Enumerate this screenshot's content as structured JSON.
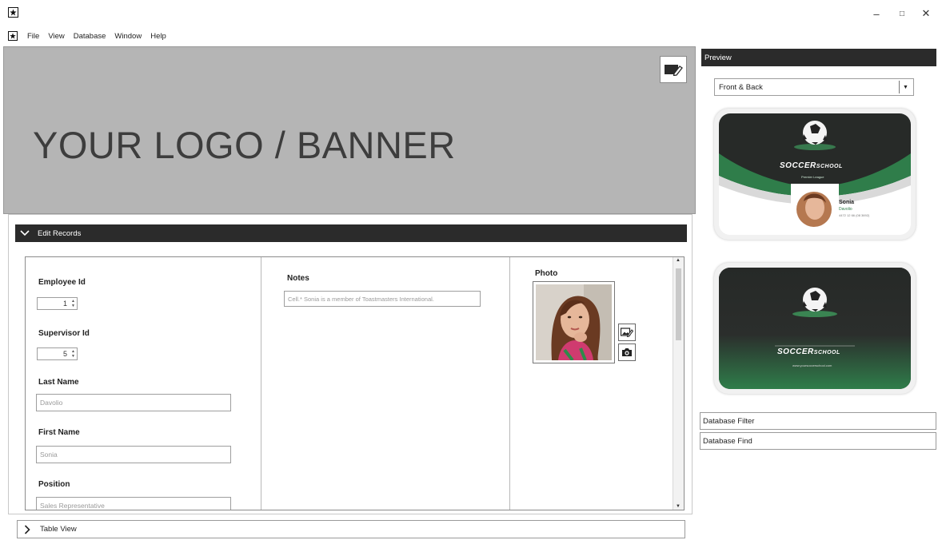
{
  "app": {
    "icon_name": "app-star-icon",
    "window_controls": {
      "minimize": "–",
      "maximize": "□",
      "close": "✕"
    }
  },
  "menu": [
    "File",
    "View",
    "Database",
    "Window",
    "Help"
  ],
  "banner": {
    "text": "YOUR LOGO / BANNER",
    "edit_icon": "edit-banner-icon"
  },
  "edit_records": {
    "title": "Edit Records",
    "fields": {
      "employee_id": {
        "label": "Employee Id",
        "value": "1"
      },
      "supervisor_id": {
        "label": "Supervisor Id",
        "value": "5"
      },
      "last_name": {
        "label": "Last Name",
        "value": "Davolio"
      },
      "first_name": {
        "label": "First Name",
        "value": "Sonia"
      },
      "position": {
        "label": "Position",
        "value": "Sales Representative"
      },
      "notes": {
        "label": "Notes",
        "value": "Cell.*  Sonia is a member of Toastmasters International."
      },
      "photo": {
        "label": "Photo"
      }
    }
  },
  "table_view": {
    "title": "Table View"
  },
  "preview": {
    "title": "Preview",
    "select_value": "Front & Back",
    "front_card": {
      "brand": "SOCCER",
      "brand_suffix": "SCHOOL",
      "tagline": "Premier League",
      "first_name": "Sonia",
      "last_name": "Davolio",
      "phone": "4472 12 66 (08 3692)"
    },
    "back_card": {
      "brand": "SOCCER",
      "brand_suffix": "SCHOOL",
      "url": "www.yoursoccerschool.com"
    }
  },
  "database_filter": "Database Filter",
  "database_find": "Database Find",
  "colors": {
    "dark_header": "#2b2b2b",
    "banner_bg": "#b5b5b5",
    "card_green": "#2f7d4a"
  }
}
